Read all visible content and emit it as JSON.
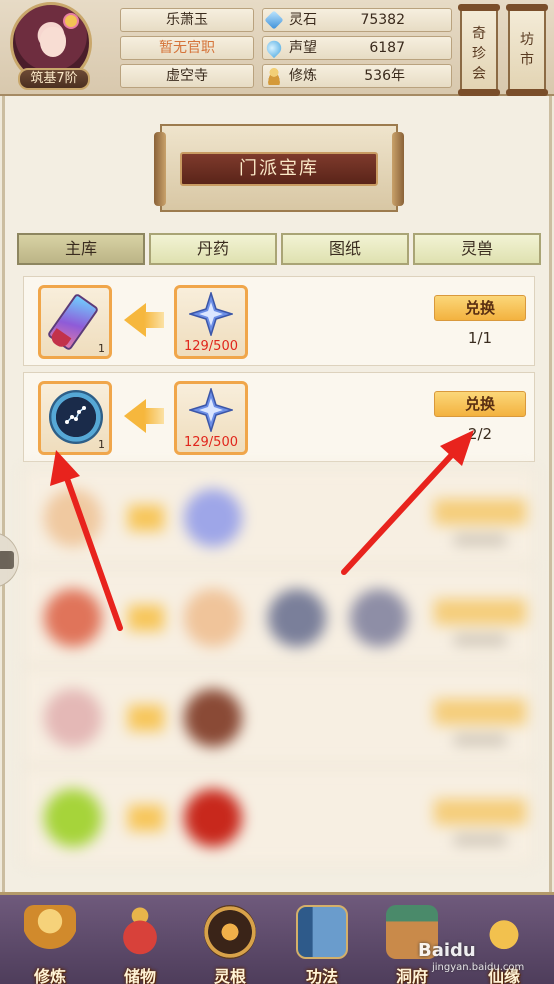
{
  "player": {
    "name": "乐萧玉",
    "official_rank": "暂无官职",
    "sect": "虚空寺",
    "realm": "筑基7阶"
  },
  "resources": [
    {
      "label": "灵石",
      "value": "75382",
      "icon": "spirit-stone-icon"
    },
    {
      "label": "声望",
      "value": "6187",
      "icon": "reputation-icon"
    },
    {
      "label": "修炼",
      "value": "536年",
      "icon": "cultivation-icon"
    }
  ],
  "top_buttons": {
    "treasure_fair": [
      "奇",
      "珍",
      "会"
    ],
    "market": [
      "坊",
      "市"
    ]
  },
  "banner": {
    "title": "门派宝库"
  },
  "tabs": [
    {
      "label": "主库",
      "active": true
    },
    {
      "label": "丹药",
      "active": false
    },
    {
      "label": "图纸",
      "active": false
    },
    {
      "label": "灵兽",
      "active": false
    }
  ],
  "exchange_rows": [
    {
      "reward_count": "1",
      "cost_progress": "129/500",
      "button_label": "兑换",
      "limit": "1/1"
    },
    {
      "reward_count": "1",
      "cost_progress": "129/500",
      "button_label": "兑换",
      "limit": "2/2"
    }
  ],
  "bottom_nav": [
    {
      "label": "修炼",
      "icon": "cultivate-icon"
    },
    {
      "label": "储物",
      "icon": "storage-bag-icon"
    },
    {
      "label": "灵根",
      "icon": "spirit-root-icon"
    },
    {
      "label": "功法",
      "icon": "technique-book-icon"
    },
    {
      "label": "洞府",
      "icon": "cave-abode-icon"
    },
    {
      "label": "仙缘",
      "icon": "immortal-fate-icon"
    }
  ],
  "watermark": {
    "text": "Baidu",
    "sub": "jingyan.baidu.com"
  },
  "colors": {
    "accent": "#f0a64a",
    "progress_red": "#e0261c",
    "annotation_red": "#e8231d"
  }
}
